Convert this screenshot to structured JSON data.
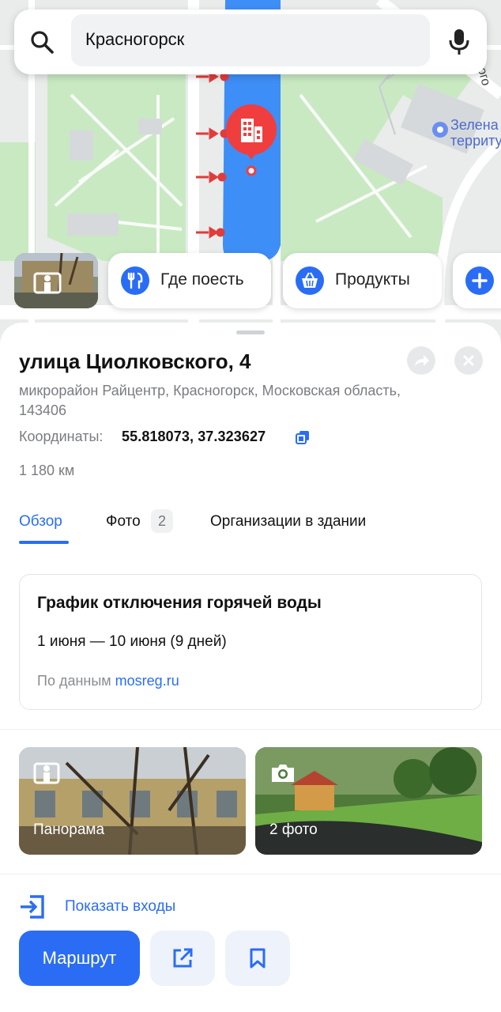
{
  "search": {
    "value": "Красногорск"
  },
  "map": {
    "poi_label": "Зелена\nтерриту",
    "road_label": "ого"
  },
  "chips": [
    {
      "label": "Где поесть",
      "icon": "fork-knife-icon"
    },
    {
      "label": "Продукты",
      "icon": "basket-icon"
    },
    {
      "label": "",
      "icon": "plus-icon"
    }
  ],
  "place": {
    "title": "улица Циолковского, 4",
    "address": "микрорайон Райцентр, Красногорск, Московская область, 143406",
    "coords_label": "Координаты:",
    "coords_value": "55.818073, 37.323627",
    "distance": "1 180 км"
  },
  "tabs": {
    "overview": "Обзор",
    "photo": "Фото",
    "photo_count": "2",
    "organizations": "Организации в здании"
  },
  "water": {
    "title": "График отключения горячей воды",
    "dates": "1 июня — 10 июня (9 дней)",
    "source_prefix": "По данным",
    "source_link": "mosreg.ru"
  },
  "tiles": {
    "panorama": "Панорама",
    "photos": "2 фото"
  },
  "actions": {
    "entrances": "Показать входы",
    "route": "Маршрут"
  },
  "colors": {
    "accent": "#2a6df4",
    "pin": "#f03e3e",
    "river": "#3e8ef7",
    "park": "#c9e9c3"
  }
}
